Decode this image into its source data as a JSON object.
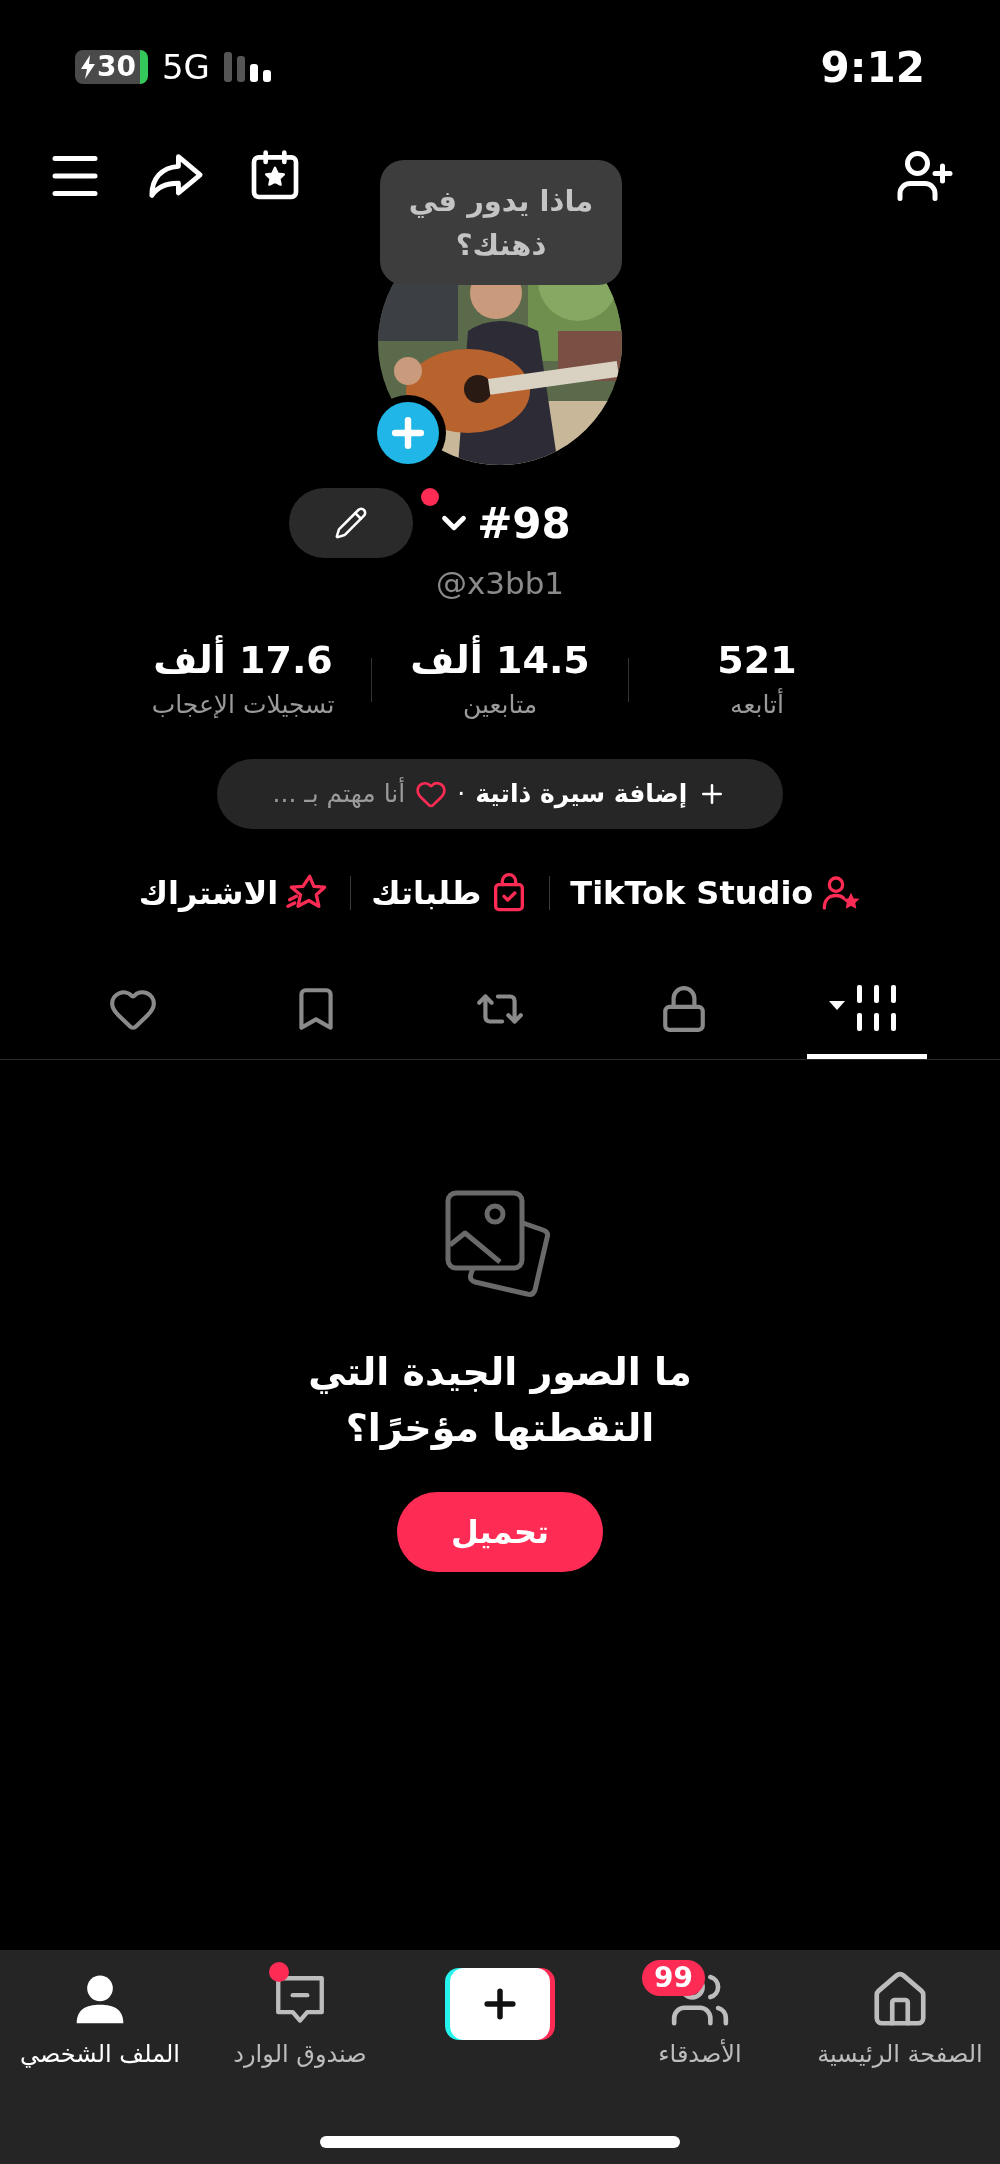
{
  "status_bar": {
    "battery": "30",
    "network": "5G",
    "time": "9:12"
  },
  "tooltip": "ماذا يدور في ذهنك؟",
  "profile": {
    "name": "#98",
    "handle": "@x3bb1",
    "notification_dot": true
  },
  "stats": [
    {
      "value": "521",
      "label": "أتابعه"
    },
    {
      "value": "14.5 ألف",
      "label": "متابعين"
    },
    {
      "value": "17.6 ألف",
      "label": "تسجيلات الإعجاب"
    }
  ],
  "bio": {
    "add": "إضافة سيرة ذاتية",
    "separator": "·",
    "interests": "أنا مهتم بـ ..."
  },
  "links": [
    {
      "kind": "studio",
      "label": "TikTok Studio"
    },
    {
      "kind": "orders",
      "label": "طلباتك"
    },
    {
      "kind": "subscription",
      "label": "الاشتراك"
    }
  ],
  "tabs": [
    {
      "kind": "grid",
      "selected": true
    },
    {
      "kind": "private",
      "selected": false
    },
    {
      "kind": "reposts",
      "selected": false
    },
    {
      "kind": "saved",
      "selected": false
    },
    {
      "kind": "liked",
      "selected": false
    }
  ],
  "empty_state": {
    "title": "ما الصور الجيدة التي التقطتها مؤخرًا؟",
    "button": "تحميل"
  },
  "bottom_nav": [
    {
      "kind": "home",
      "label": "الصفحة الرئيسية",
      "selected": false
    },
    {
      "kind": "friends",
      "label": "الأصدقاء",
      "badge": "99",
      "selected": false
    },
    {
      "kind": "create",
      "selected": false
    },
    {
      "kind": "inbox",
      "label": "صندوق الوارد",
      "dot": true,
      "selected": false
    },
    {
      "kind": "profile",
      "label": "الملف الشخصي",
      "selected": true
    }
  ]
}
